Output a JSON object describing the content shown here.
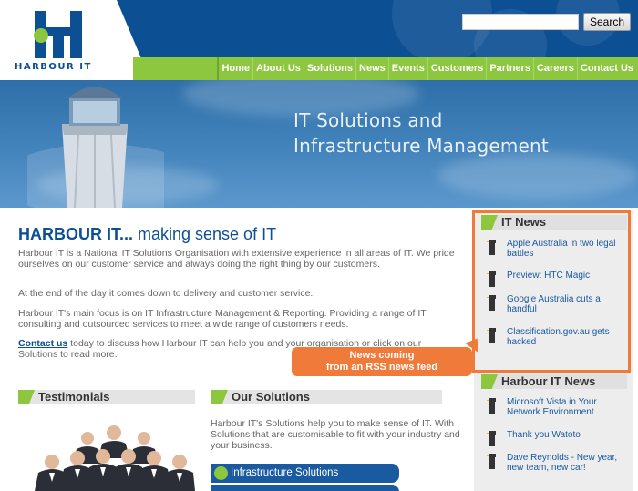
{
  "brand": {
    "name": "HARBOUR IT",
    "green": "#8dc63f",
    "blue": "#0d4f93",
    "orange": "#f07a3a"
  },
  "search": {
    "button_label": "Search",
    "value": ""
  },
  "nav": [
    "Home",
    "About Us",
    "Solutions",
    "News",
    "Events",
    "Customers",
    "Partners",
    "Careers",
    "Contact Us"
  ],
  "banner": {
    "line1": "IT Solutions and",
    "line2": "Infrastructure Management"
  },
  "main": {
    "heading_brand": "HARBOUR IT...",
    "heading_tagline": " making sense of IT",
    "para1": "Harbour IT is a National IT Solutions Organisation with extensive experience in all areas of IT. We pride ourselves on our customer service and always doing the right thing by our customers.",
    "para2": "At the end of the day it comes down to delivery and customer service.",
    "para3": "Harbour IT's main focus is on IT Infrastructure Management & Reporting. Providing a range of IT consulting and outsourced services to meet a wide range of customers needs.",
    "contact_link": "Contact us",
    "para4_rest": " today to discuss how Harbour IT can help you and your organisation or click on our Solutions to read more."
  },
  "testimonials": {
    "title": "Testimonials"
  },
  "solutions": {
    "title": "Our Solutions",
    "text": "Harbour IT's Solutions help you to make sense of IT. With Solutions that are customisable to fit with your industry and your business.",
    "button": "Infrastructure Solutions"
  },
  "it_news": {
    "title": "IT News",
    "items": [
      "Apple Australia in two legal battles",
      "Preview: HTC Magic",
      "Google Australia cuts a handful",
      "Classification.gov.au gets hacked"
    ]
  },
  "harbour_news": {
    "title": "Harbour IT News",
    "items": [
      "Microsoft Vista in Your Network Environment",
      "Thank you Watoto",
      "Dave Reynolds - New year, new team, new car!"
    ]
  },
  "callout": {
    "line1": "News coming",
    "line2": "from an RSS news feed"
  }
}
